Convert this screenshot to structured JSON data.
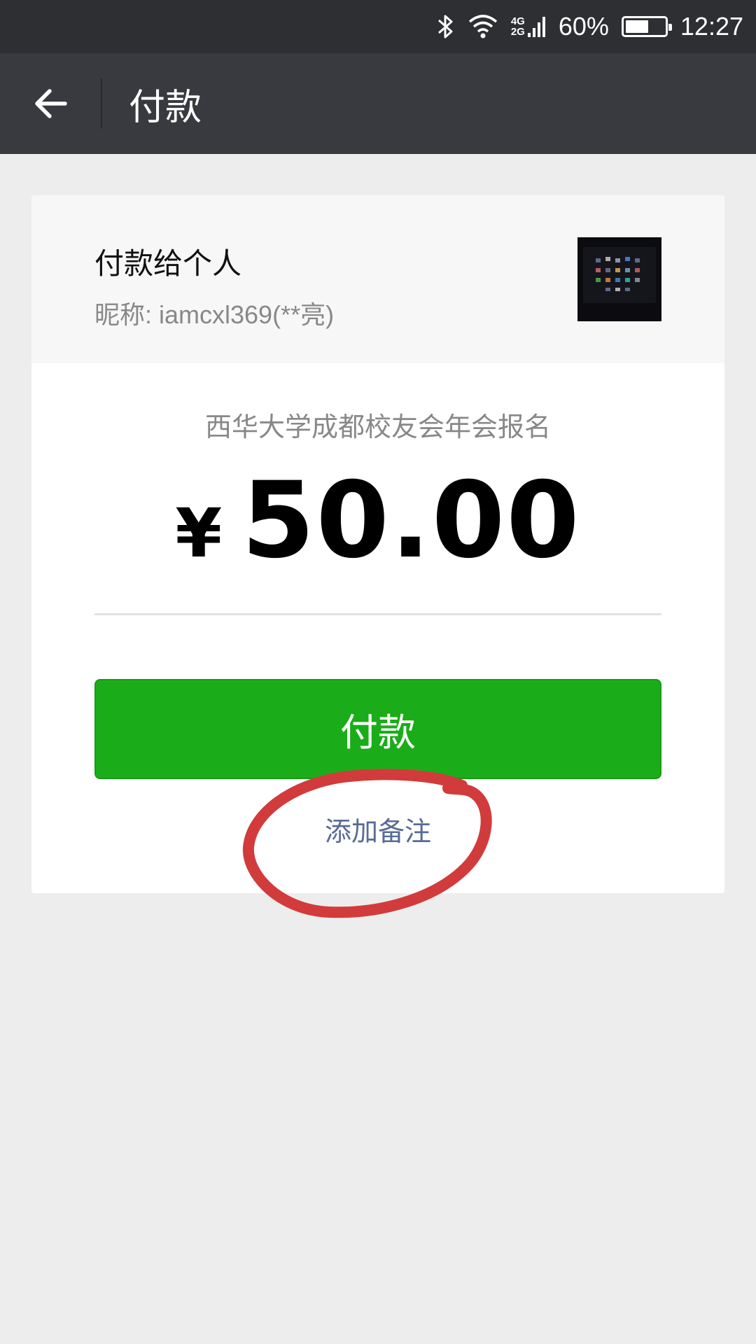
{
  "status_bar": {
    "network_top": "4G",
    "network_bottom": "2G",
    "battery_percent": "60%",
    "battery_level": 0.6,
    "time": "12:27",
    "icons": [
      "bluetooth-icon",
      "wifi-icon",
      "signal-icon",
      "battery-icon"
    ]
  },
  "header": {
    "title": "付款",
    "back_icon": "back-arrow-icon"
  },
  "payee": {
    "label": "付款给个人",
    "nickname": "昵称: iamcxl369(**亮)"
  },
  "payment": {
    "memo": "西华大学成都校友会年会报名",
    "currency": "¥",
    "amount": "50.00",
    "pay_button_label": "付款",
    "add_note_label": "添加备注"
  },
  "colors": {
    "pay_button": "#1aad19",
    "link": "#576b95",
    "annotation": "#d23b3b",
    "title_bar": "#393a3f"
  }
}
